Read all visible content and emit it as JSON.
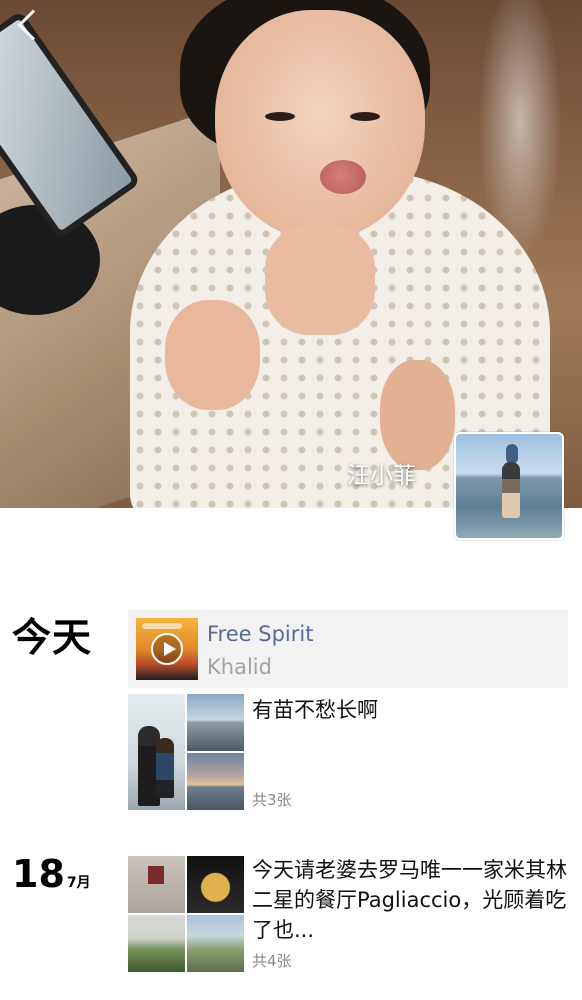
{
  "profile": {
    "name": "汪小菲"
  },
  "timeline": [
    {
      "day_label": "今天",
      "music": {
        "title": "Free Spirit",
        "artist": "Khalid"
      },
      "post": {
        "text": "有苗不愁长啊",
        "photo_count": "共3张"
      }
    },
    {
      "day": "18",
      "month": "7月",
      "post": {
        "text": "今天请老婆去罗马唯一一家米其林二星的餐厅Pagliaccio，光顾着吃了也...",
        "photo_count": "共4张"
      }
    }
  ],
  "colors": {
    "link_blue": "#576b95",
    "muted_gray": "#a3a3a3",
    "card_bg": "#f2f2f2"
  },
  "icons": {
    "back": "back-arrow-icon",
    "play": "play-icon"
  }
}
